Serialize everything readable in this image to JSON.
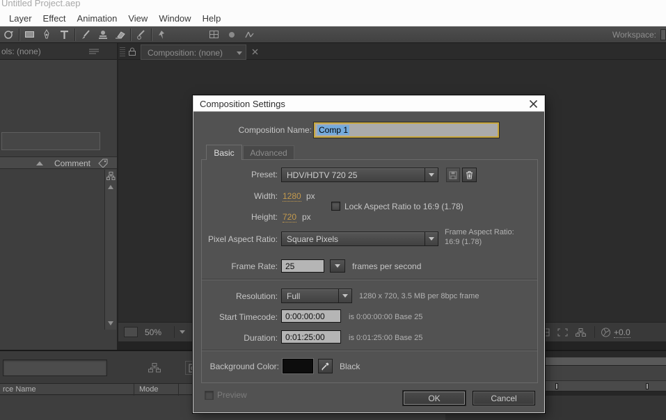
{
  "window": {
    "title": "Untitled Project.aep"
  },
  "menu": {
    "items": [
      "Layer",
      "Effect",
      "Animation",
      "View",
      "Window",
      "Help"
    ]
  },
  "toolbar": {
    "workspace_label": "Workspace:"
  },
  "left_panel": {
    "tab_label": "ols: (none)",
    "comment_header": "Comment"
  },
  "comp_panel": {
    "tab_label": "Composition: (none)",
    "zoom_value": "50%",
    "motion_blur_value": "+0.0"
  },
  "timeline": {
    "source_name_header": "rce Name",
    "mode_header": "Mode"
  },
  "dialog": {
    "title": "Composition Settings",
    "composition_name": {
      "label": "Composition Name:",
      "value": "Comp 1"
    },
    "tabs": {
      "basic": "Basic",
      "advanced": "Advanced"
    },
    "preset": {
      "label": "Preset:",
      "value": "HDV/HDTV 720 25"
    },
    "width": {
      "label": "Width:",
      "value": "1280",
      "unit": "px"
    },
    "height": {
      "label": "Height:",
      "value": "720",
      "unit": "px"
    },
    "lock_aspect_label": "Lock Aspect Ratio to 16:9 (1.78)",
    "pixel_aspect_ratio": {
      "label": "Pixel Aspect Ratio:",
      "value": "Square Pixels"
    },
    "frame_aspect_ratio": {
      "label": "Frame Aspect Ratio:",
      "value": "16:9 (1.78)"
    },
    "frame_rate": {
      "label": "Frame Rate:",
      "value": "25",
      "suffix": "frames per second"
    },
    "resolution": {
      "label": "Resolution:",
      "value": "Full",
      "info": "1280 x 720, 3.5 MB per 8bpc frame"
    },
    "start_timecode": {
      "label": "Start Timecode:",
      "value": "0:00:00:00",
      "info": "is 0:00:00:00  Base 25"
    },
    "duration": {
      "label": "Duration:",
      "value": "0:01:25:00",
      "info": "is 0:01:25:00  Base 25"
    },
    "background_color": {
      "label": "Background Color:",
      "name": "Black"
    },
    "preview_label": "Preview",
    "buttons": {
      "ok": "OK",
      "cancel": "Cancel"
    }
  },
  "icons": [
    "rotation-tool-icon",
    "rectangle-tool-icon",
    "pen-tool-icon",
    "type-tool-icon",
    "brush-tool-icon",
    "clone-stamp-tool-icon",
    "eraser-tool-icon",
    "rotobrush-tool-icon",
    "puppet-pin-tool-icon",
    "camera-icon",
    "grid-icon",
    "lock-icon",
    "tag-icon",
    "flowchart-icon",
    "close-icon",
    "trash-icon",
    "save-preset-icon",
    "eyedropper-icon",
    "shutter-icon"
  ],
  "colors": {
    "accent_gold": "#c49a4d",
    "name_field_border": "#c9a83c",
    "selection_blue": "#74aadc",
    "dialog_bg": "#525252",
    "bg_color_swatch": "#0d0d0d"
  }
}
